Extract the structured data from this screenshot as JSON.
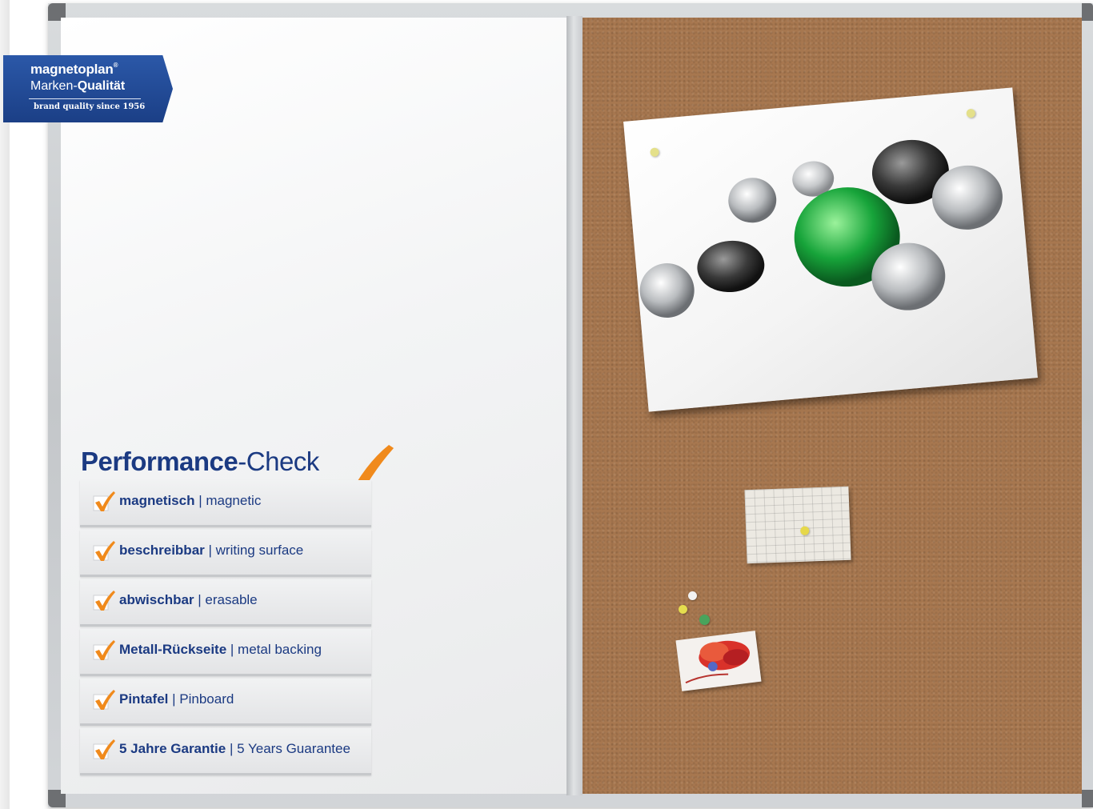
{
  "logo": {
    "brand": "magnetoplan",
    "registered": "®",
    "quality_prefix": "Marken-",
    "quality_strong": "Qualität",
    "since": "brand quality since 1956"
  },
  "performance": {
    "title_strong": "Performance",
    "title_light": "-Check",
    "items": [
      {
        "de": "magnetisch",
        "sep": " | ",
        "en": "magnetic"
      },
      {
        "de": "beschreibbar",
        "sep": " | ",
        "en": "writing surface"
      },
      {
        "de": "abwischbar",
        "sep": " | ",
        "en": "erasable"
      },
      {
        "de": "Metall-Rückseite",
        "sep": " | ",
        "en": "metal backing"
      },
      {
        "de": "Pintafel",
        "sep": " | ",
        "en": "Pinboard"
      },
      {
        "de": "5 Jahre Garantie",
        "sep": " | ",
        "en": "5 Years Guarantee"
      }
    ]
  },
  "colors": {
    "brand_blue": "#1b3a82",
    "check_orange": "#f08a1c",
    "cork": "#a7774f"
  }
}
